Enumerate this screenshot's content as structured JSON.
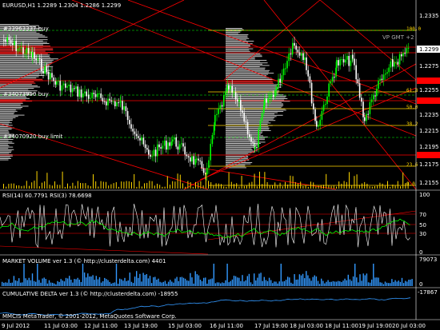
{
  "symbol_title": "EURUSD,H1  1.2289 1.2304 1.2286 1.2299",
  "orders": [
    {
      "label": "#33963337 buy"
    },
    {
      "label": "#34073950 buy"
    },
    {
      "label": "#34070920 buy limit"
    }
  ],
  "vp_label": "VP GMT +2",
  "price_axis": [
    "1.2335",
    "1.2299",
    "1.2275",
    "1.2255",
    "1.2235",
    "1.2215",
    "1.2195",
    "1.2175",
    "1.2155"
  ],
  "current_price": "1.2299",
  "fib_labels": [
    "100.0",
    "61.8",
    "50.0",
    "38.2",
    "23.6",
    "0.0"
  ],
  "rsi": {
    "title": "RSI(14) 60.7791  RSI(3) 78.6698",
    "levels": [
      "100",
      "70",
      "50",
      "30",
      "0"
    ]
  },
  "volume": {
    "title": "MARKET VOLUME  ver 1.3  (© http://clusterdelta.com)  4401",
    "max": "79073",
    "min": "0"
  },
  "delta": {
    "title": "CUMULATIVE DELTA  ver 1.3  (© http://clusterdelta.com)  -18955",
    "value": "-17867"
  },
  "footer": "MMCIS MetaTrader, © 2001-2012, MetaQuotes Software Corp.",
  "time_axis": [
    "9 Jul 2012",
    "11 Jul 03:00",
    "12 Jul 11:00",
    "13 Jul 19:00",
    "15 Jul 03:00",
    "16 Jul 11:00",
    "17 Jul 19:00",
    "18 Jul 03:00",
    "18 Jul 11:00",
    "19 Jul 19:00",
    "20 Jul 03:00"
  ],
  "colors": {
    "bull": "#00ff00",
    "bear": "#ffffff",
    "sr": "#ff0000",
    "fib": "#ffd700",
    "rsi_fast": "#ffffff",
    "rsi_slow": "#00ff00",
    "vol": "#3399ff"
  }
}
